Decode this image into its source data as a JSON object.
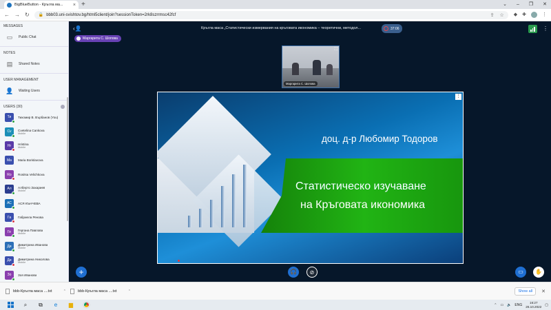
{
  "browser": {
    "tab_title": "BigBlueButton - Кръгла ма...",
    "url": "bbb03.uni-svishtov.bg/html5client/join?sessionToken=2rk8szrrmsc42fcf",
    "new_tab": "+",
    "close": "×"
  },
  "sidebar": {
    "messages_title": "MESSAGES",
    "public_chat": "Public Chat",
    "notes_title": "NOTES",
    "shared_notes": "Shared Notes",
    "user_mgmt_title": "USER MANAGEMENT",
    "waiting_users": "Waiting Users",
    "users_title": "USERS (30)",
    "users": [
      {
        "initials": "Ти",
        "name": "Тихомир В. Върбанов (You)",
        "sub": "",
        "color": "#3a4fae",
        "dot": "#2ea043"
      },
      {
        "initials": "Cv",
        "name": "Cvetelina Cankova",
        "sub": "Mobile",
        "color": "#1b8fb7",
        "dot": "#2ea043"
      },
      {
        "initials": "Hr",
        "name": "Hristina",
        "sub": "Mobile",
        "color": "#5a3aa8",
        "dot": "#d73a49"
      },
      {
        "initials": "Ma",
        "name": "Maria Borislavova",
        "sub": "",
        "color": "#3a4fae",
        "dot": ""
      },
      {
        "initials": "Ro",
        "name": "Rositsa Velichkova",
        "sub": "",
        "color": "#8a3fae",
        "dot": "#d73a49"
      },
      {
        "initials": "Ал",
        "name": "Алберто Захариев",
        "sub": "Mobile",
        "color": "#2c3e8f",
        "dot": "#2ea043"
      },
      {
        "initials": "АС",
        "name": "АСЯ КЪНЧЕВА",
        "sub": "",
        "color": "#1b6fb7",
        "dot": "#2ea043"
      },
      {
        "initials": "Га",
        "name": "Габриела Ренова",
        "sub": "",
        "color": "#3a4fae",
        "dot": "#d73a49"
      },
      {
        "initials": "Ге",
        "name": "Гергана Павлова",
        "sub": "Mobile",
        "color": "#8a3fae",
        "dot": "#2ea043"
      },
      {
        "initials": "Ди",
        "name": "Димитрина Иванова",
        "sub": "Mobile",
        "color": "#2c6fb7",
        "dot": "#2ea043"
      },
      {
        "initials": "Ди",
        "name": "Димитрина Николова",
        "sub": "Mobile",
        "color": "#3a4fae",
        "dot": "#d73a49"
      },
      {
        "initials": "Зо",
        "name": "Зоя Иванова",
        "sub": "",
        "color": "#8a3fae",
        "dot": "#2ea043"
      },
      {
        "initials": "Ив",
        "name": "Ивайло О. Костов",
        "sub": "",
        "color": "#2c3e8f",
        "dot": ""
      }
    ]
  },
  "topbar": {
    "meeting_title": "Кръгла маса „Статистически измервания на кръговата икономика – теоретични, методол...",
    "recording_time": "37:06"
  },
  "talker": "Маргарита С. Шопова",
  "webcam_caption": "Маргарита С. Шопова",
  "slide": {
    "author": "доц. д-р Любомир Тодоров",
    "title_line1": "Статистическо изучаване",
    "title_line2": "на Кръговата икономика",
    "chart_bars": [
      0.18,
      0.28,
      0.42,
      0.62,
      0.8,
      0.95
    ]
  },
  "downloads": [
    {
      "name": "bbb-Кръгла маса ....txt"
    },
    {
      "name": "bbb-Кръгла маса ....txt"
    }
  ],
  "show_all": "Show all",
  "taskbar": {
    "language": "ENG",
    "time": "16:27",
    "date": "26.10.2022"
  },
  "colors": {
    "accent": "#1f6fd1",
    "app_bg": "#06172a",
    "talker": "#6842b5",
    "green": "#21b414"
  }
}
